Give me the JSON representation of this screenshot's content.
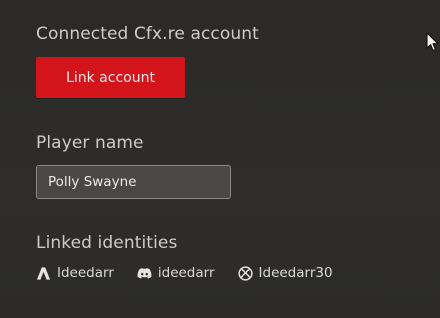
{
  "account": {
    "section_title": "Connected Cfx.re account",
    "link_button_label": "Link account"
  },
  "player": {
    "section_title": "Player name",
    "name_value": "Polly Swayne"
  },
  "identities": {
    "section_title": "Linked identities",
    "items": [
      {
        "icon": "cfx-icon",
        "label": "Ideedarr"
      },
      {
        "icon": "discord-icon",
        "label": "ideedarr"
      },
      {
        "icon": "xbox-icon",
        "label": "Ideedarr30"
      }
    ]
  },
  "colors": {
    "background": "#2d2c2a",
    "accent_red": "#d3141a",
    "text": "#d6d3cd",
    "input_bg": "#4a4845",
    "input_border": "#8d8a85"
  }
}
